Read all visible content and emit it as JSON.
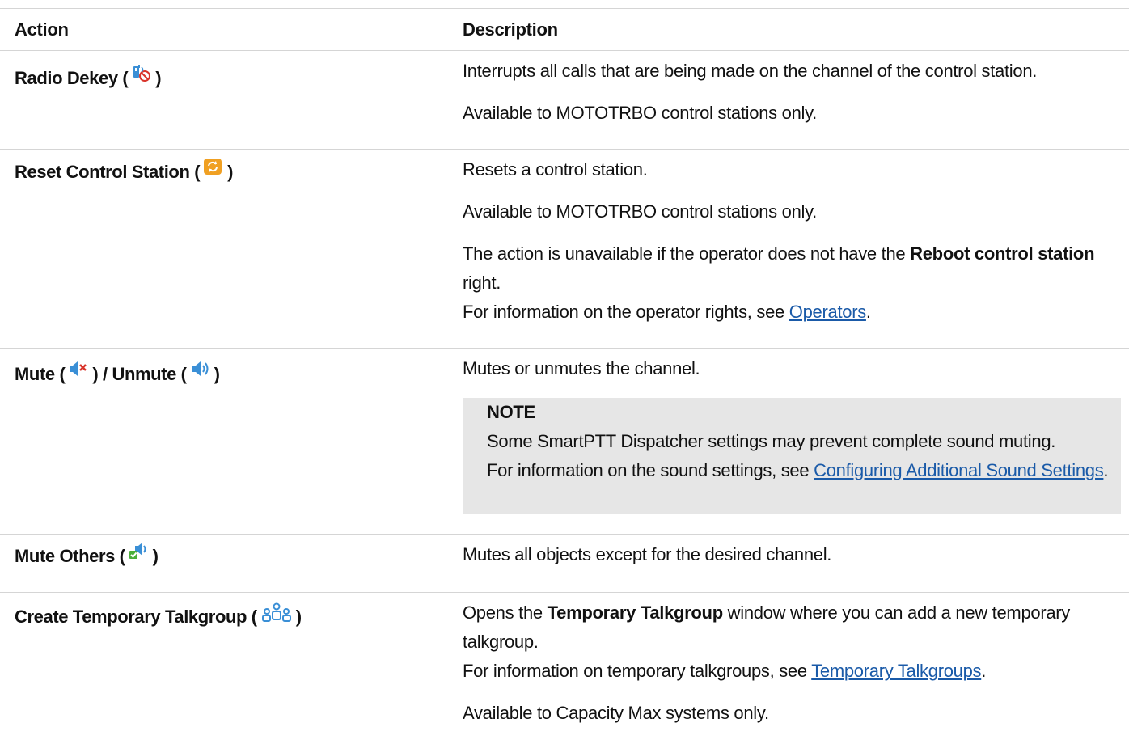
{
  "header": {
    "action": "Action",
    "description": "Description"
  },
  "rows": [
    {
      "action_label": "Radio Dekey",
      "icon": "radio-dekey-icon",
      "desc1": "Interrupts all calls that are being made on the channel of the control station.",
      "desc2": "Available to MOTOTRBO control stations only."
    },
    {
      "action_label": "Reset Control Station",
      "icon": "reset-icon",
      "desc1": "Resets a control station.",
      "desc2": "Available to MOTOTRBO control stations only.",
      "desc3_pre": "The action is unavailable if the operator does not have the ",
      "desc3_bold": "Reboot control station",
      "desc3_post": " right.",
      "desc4_pre": "For information on the operator rights, see ",
      "desc4_link": "Operators",
      "desc4_post": "."
    },
    {
      "action_label_a": "Mute",
      "action_label_b": "Unmute",
      "icon_a": "speaker-muted-icon",
      "icon_b": "speaker-icon",
      "desc1": "Mutes or unmutes the channel.",
      "note_title": "NOTE",
      "note_line1": "Some SmartPTT Dispatcher settings may prevent complete sound muting.",
      "note_line2_pre": "For information on the sound settings, see ",
      "note_line2_link": "Configuring Additional Sound Settings",
      "note_line2_post": "."
    },
    {
      "action_label": "Mute Others",
      "icon": "mute-others-icon",
      "desc1": "Mutes all objects except for the desired channel."
    },
    {
      "action_label": "Create Temporary Talkgroup",
      "icon": "talkgroup-icon",
      "desc1_pre": "Opens the ",
      "desc1_bold": "Temporary Talkgroup",
      "desc1_post": " window where you can add a new temporary talkgroup.",
      "desc2_pre": "For information on temporary talkgroups, see ",
      "desc2_link": "Temporary Talkgroups",
      "desc2_post": ".",
      "desc3": "Available to Capacity Max systems only."
    }
  ],
  "colors": {
    "link": "#1a5aa8",
    "rule": "#d5d5d5",
    "note_bg": "#e6e6e6"
  }
}
